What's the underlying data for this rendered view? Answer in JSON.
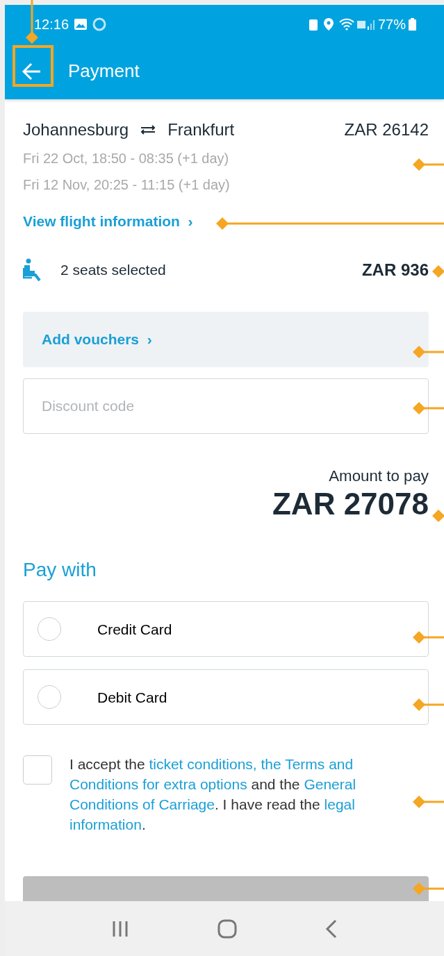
{
  "status_bar": {
    "time": "12:16",
    "battery": "77%"
  },
  "app_bar": {
    "title": "Payment"
  },
  "trip": {
    "origin": "Johannesburg",
    "destination": "Frankfurt",
    "price": "ZAR 26142",
    "legs": [
      "Fri 22 Oct, 18:50 - 08:35 (+1 day)",
      "Fri 12 Nov, 20:25 - 11:15 (+1 day)"
    ],
    "details_link": "View flight information",
    "details_chevron": "›"
  },
  "seats": {
    "label": "2 seats selected",
    "price": "ZAR 936"
  },
  "vouchers": {
    "label": "Add vouchers",
    "chevron": "›"
  },
  "discount": {
    "placeholder": "Discount code"
  },
  "amount": {
    "label": "Amount to pay",
    "value": "ZAR 27078"
  },
  "pay_with": {
    "heading": "Pay with",
    "options": [
      {
        "label": "Credit Card",
        "selected": false
      },
      {
        "label": "Debit Card",
        "selected": false
      }
    ]
  },
  "agreement": {
    "checked": false,
    "segments": [
      {
        "text": "I accept the",
        "link": false,
        "space_after": true
      },
      {
        "text": "ticket conditions, the Terms and",
        "link": true,
        "space_after": true
      },
      {
        "text": "Conditions for extra options",
        "link": true,
        "space_after": true
      },
      {
        "text": "and the",
        "link": false,
        "space_after": true
      },
      {
        "text": "General",
        "link": true,
        "space_after": true
      },
      {
        "text": "Conditions of Carriage",
        "link": true,
        "space_after": false
      },
      {
        "text": ". I have read the",
        "link": false,
        "space_after": true
      },
      {
        "text": "legal",
        "link": true,
        "space_after": true
      },
      {
        "text": "information",
        "link": true,
        "space_after": false
      },
      {
        "text": ".",
        "link": false,
        "space_after": false
      }
    ]
  },
  "continue_button": {
    "disabled": true
  }
}
